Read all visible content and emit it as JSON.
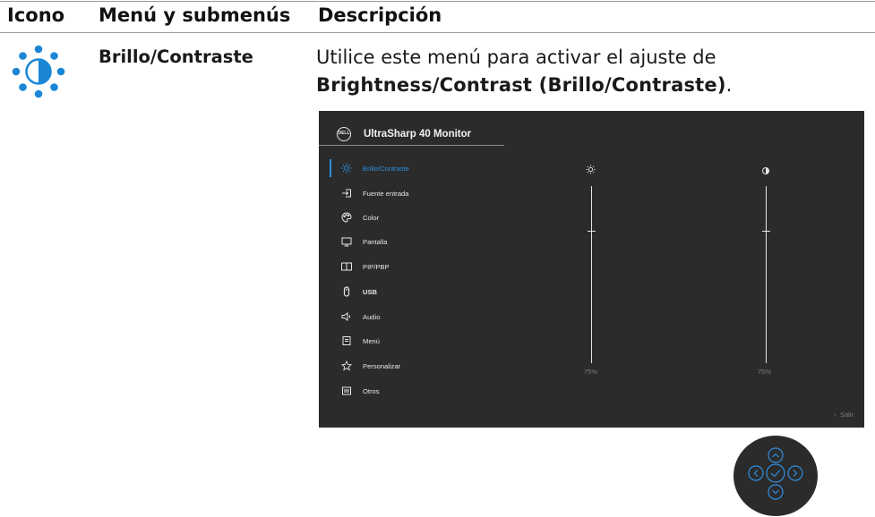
{
  "table": {
    "headers": {
      "icon": "Icono",
      "menu": "Menú y submenús",
      "description": "Descripción"
    },
    "row": {
      "icon": "brightness-contrast-icon",
      "menu_name": "Brillo/Contraste",
      "desc_line1": "Utilice este menú para activar el ajuste de",
      "desc_line2": "Brightness/Contrast (Brillo/Contraste)",
      "desc_line2_end": "."
    }
  },
  "osd": {
    "title": "UltraSharp 40 Monitor",
    "logo_text": "DELL",
    "menu": [
      {
        "label": "Brillo/Contraste",
        "icon": "brightness-icon",
        "active": true
      },
      {
        "label": "Fuente entrada",
        "icon": "input-source-icon"
      },
      {
        "label": "Color",
        "icon": "palette-icon"
      },
      {
        "label": "Pantalla",
        "icon": "display-icon"
      },
      {
        "label": "PIP/PBP",
        "icon": "pip-icon"
      },
      {
        "label": "USB",
        "icon": "mouse-icon"
      },
      {
        "label": "Audio",
        "icon": "speaker-icon"
      },
      {
        "label": "Menú",
        "icon": "menu-icon"
      },
      {
        "label": "Personalizar",
        "icon": "star-icon"
      },
      {
        "label": "Otros",
        "icon": "others-icon"
      }
    ],
    "brightness": {
      "icon": "sun-icon",
      "value_text": "75%",
      "level": 0.75
    },
    "contrast": {
      "icon": "contrast-icon",
      "value_text": "75%",
      "level": 0.75
    },
    "exit_label": "Salir",
    "colors": {
      "background": "#2b2b2b",
      "accent": "#2f8fe0"
    }
  },
  "joystick": {
    "icons": [
      "up-icon",
      "left-icon",
      "check-icon",
      "right-icon",
      "down-icon"
    ]
  }
}
